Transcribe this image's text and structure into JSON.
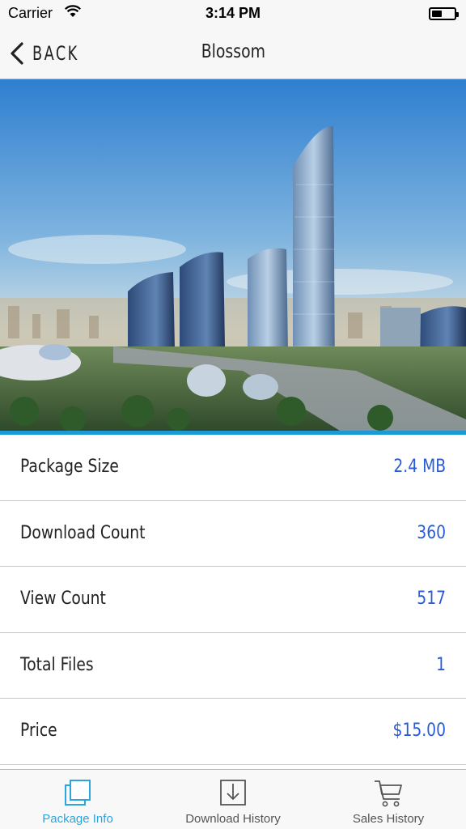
{
  "status_bar": {
    "carrier": "Carrier",
    "time": "3:14 PM",
    "battery_level": 0.45
  },
  "nav": {
    "back_label": "BACK",
    "title": "Blossom"
  },
  "hero": {
    "alt": "Rendering of modern high-rise skyscrapers and domed buildings"
  },
  "info": {
    "rows": [
      {
        "label": "Package Size",
        "value": "2.4 MB"
      },
      {
        "label": "Download Count",
        "value": "360"
      },
      {
        "label": "View Count",
        "value": "517"
      },
      {
        "label": "Total Files",
        "value": "1"
      },
      {
        "label": "Price",
        "value": "$15.00"
      }
    ]
  },
  "tabs": {
    "items": [
      {
        "label": "Package Info",
        "icon": "package-icon",
        "active": true
      },
      {
        "label": "Download History",
        "icon": "download-icon",
        "active": false
      },
      {
        "label": "Sales History",
        "icon": "cart-icon",
        "active": false
      }
    ]
  },
  "colors": {
    "accent": "#2ba5dd",
    "value_text": "#2a5bd7",
    "hero_underline": "#1c9ad6"
  }
}
